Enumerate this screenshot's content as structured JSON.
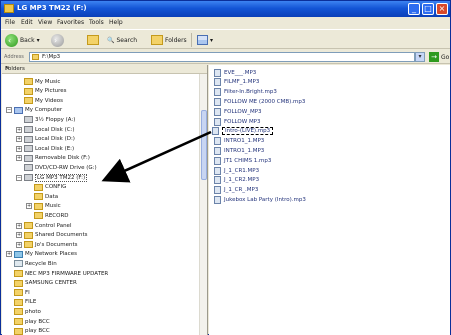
{
  "window": {
    "title": "LG MP3 TM22 (F:)",
    "min": "_",
    "max": "□",
    "close": "×"
  },
  "menu": [
    "File",
    "Edit",
    "View",
    "Favorites",
    "Tools",
    "Help"
  ],
  "toolbar": {
    "back": "Back",
    "search": "Search",
    "folders": "Folders"
  },
  "address": {
    "label": "Address",
    "value": "F:\\Mp3",
    "go": "Go"
  },
  "folders_pane": {
    "header": "Folders",
    "nodes": [
      {
        "label": "My Music",
        "indent": 1,
        "icon": "folder",
        "exp": ""
      },
      {
        "label": "My Pictures",
        "indent": 1,
        "icon": "folder",
        "exp": ""
      },
      {
        "label": "My Videos",
        "indent": 1,
        "icon": "folder",
        "exp": ""
      },
      {
        "label": "My Computer",
        "indent": 0,
        "icon": "pc",
        "exp": "−"
      },
      {
        "label": "3½ Floppy (A:)",
        "indent": 1,
        "icon": "drive",
        "exp": ""
      },
      {
        "label": "Local Disk (C:)",
        "indent": 1,
        "icon": "drive",
        "exp": "+"
      },
      {
        "label": "Local Disk (D:)",
        "indent": 1,
        "icon": "drive",
        "exp": "+"
      },
      {
        "label": "Local Disk (E:)",
        "indent": 1,
        "icon": "drive",
        "exp": "+"
      },
      {
        "label": "Removable Disk (F:)",
        "indent": 1,
        "icon": "drive",
        "exp": "+"
      },
      {
        "label": "DVD/CD-RW Drive (G:)",
        "indent": 1,
        "icon": "drive",
        "exp": ""
      },
      {
        "label": "LG MP3 TM22 (F:)",
        "indent": 1,
        "icon": "drive",
        "exp": "−",
        "selected": true
      },
      {
        "label": "CONFIG",
        "indent": 2,
        "icon": "folder",
        "exp": ""
      },
      {
        "label": "Data",
        "indent": 2,
        "icon": "folder",
        "exp": ""
      },
      {
        "label": "Music",
        "indent": 2,
        "icon": "folder",
        "exp": "+"
      },
      {
        "label": "RECORD",
        "indent": 2,
        "icon": "folder",
        "exp": ""
      },
      {
        "label": "Control Panel",
        "indent": 1,
        "icon": "folder",
        "exp": "+"
      },
      {
        "label": "Shared Documents",
        "indent": 1,
        "icon": "folder",
        "exp": "+"
      },
      {
        "label": "Jo's Documents",
        "indent": 1,
        "icon": "folder",
        "exp": "+"
      },
      {
        "label": "My Network Places",
        "indent": 0,
        "icon": "net",
        "exp": "+"
      },
      {
        "label": "Recycle Bin",
        "indent": 0,
        "icon": "recycle",
        "exp": ""
      },
      {
        "label": "NEC MP3 FIRMWARE UPDATER",
        "indent": 0,
        "icon": "folder",
        "exp": ""
      },
      {
        "label": "SAMSUNG CENTER",
        "indent": 0,
        "icon": "folder",
        "exp": ""
      },
      {
        "label": "FI",
        "indent": 0,
        "icon": "folder",
        "exp": ""
      },
      {
        "label": "FILE",
        "indent": 0,
        "icon": "folder",
        "exp": ""
      },
      {
        "label": "photo",
        "indent": 0,
        "icon": "folder",
        "exp": ""
      },
      {
        "label": "play BCC",
        "indent": 0,
        "icon": "folder",
        "exp": ""
      },
      {
        "label": "play BCC",
        "indent": 0,
        "icon": "folder",
        "exp": ""
      }
    ]
  },
  "files": [
    "EVE___.MP3",
    "FILMF_1.MP3",
    "Filter-In.Bright.mp3",
    "FOLLOW ME (2000 CMB).mp3",
    "FOLLOW_MP3",
    "FOLLOW MP3",
    "Intro-(LIVE).mp3",
    "INTRO1_1.MP3",
    "INTRO1_1.MP3",
    "JT1 CHIMS 1.mp3",
    "J_1_CR1.MP3",
    "J_1_CR2.MP3",
    "J_1_CR_.MP3",
    "Jukebox Lab Party (Intro).mp3"
  ],
  "focused_file_index": 6,
  "colors": {
    "titlebar": "#1455d6",
    "file_text": "#22327a",
    "folder": "#f3d268"
  }
}
